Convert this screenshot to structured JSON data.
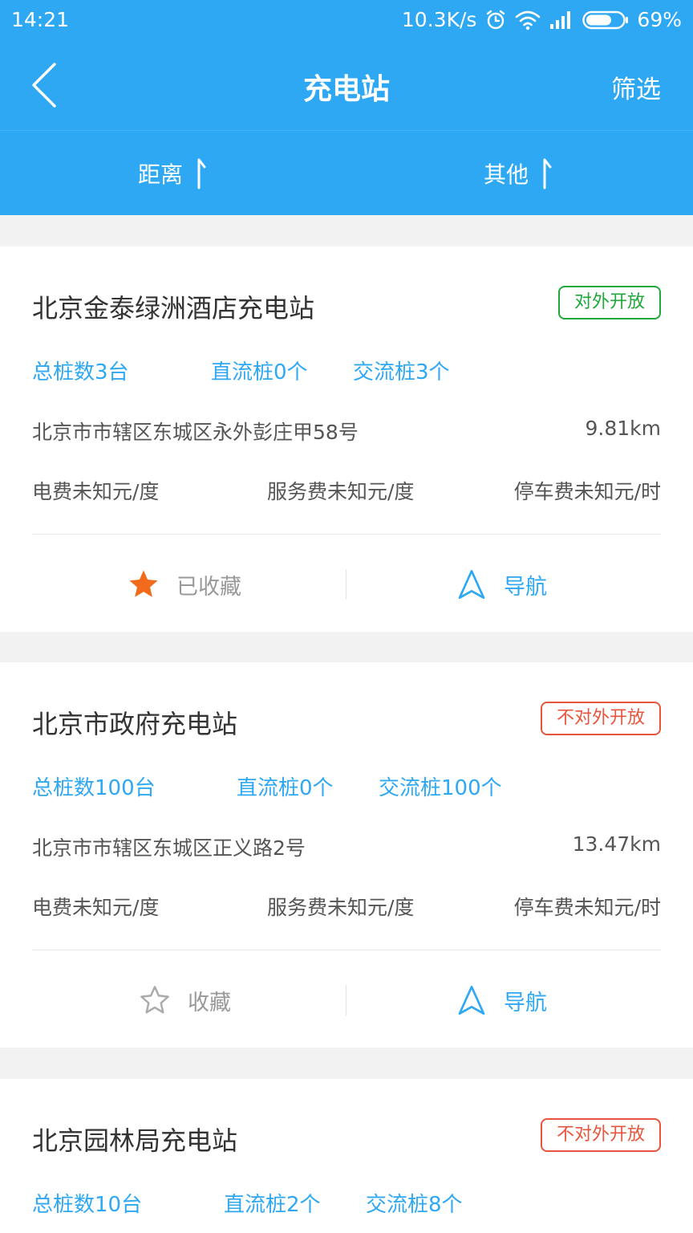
{
  "status_bar": {
    "time": "14:21",
    "net_speed": "10.3K/s",
    "battery_percent": "69%",
    "battery_level": 0.69,
    "icons": [
      "alarm-icon",
      "wifi-icon",
      "signal-icon",
      "battery-icon"
    ]
  },
  "header": {
    "title": "充电站",
    "filter_label": "筛选",
    "sort_tabs": [
      {
        "label": "距离",
        "icon": "sort-arrow-icon"
      },
      {
        "label": "其他",
        "icon": "sort-arrow-icon"
      }
    ]
  },
  "colors": {
    "primary": "#2ea8f3",
    "open": "#1fa83a",
    "closed": "#e8553d",
    "favorite_star": "#f26b1d"
  },
  "stations": [
    {
      "name": "北京金泰绿洲酒店充电站",
      "status": "对外开放",
      "total": "总桩数3台",
      "dc": "直流桩0个",
      "ac": "交流桩3个",
      "address": "北京市市辖区东城区永外彭庄甲58号",
      "distance": "9.81km",
      "electric_fee": "电费未知元/度",
      "service_fee": "服务费未知元/度",
      "parking_fee": "停车费未知元/时",
      "favorite_label": "已收藏",
      "favorited": true,
      "nav_label": "导航"
    },
    {
      "name": "北京市政府充电站",
      "status": "不对外开放",
      "total": "总桩数100台",
      "dc": "直流桩0个",
      "ac": "交流桩100个",
      "address": "北京市市辖区东城区正义路2号",
      "distance": "13.47km",
      "electric_fee": "电费未知元/度",
      "service_fee": "服务费未知元/度",
      "parking_fee": "停车费未知元/时",
      "favorite_label": "收藏",
      "favorited": false,
      "nav_label": "导航"
    },
    {
      "name": "北京园林局充电站",
      "status": "不对外开放",
      "total": "总桩数10台",
      "dc": "直流桩2个",
      "ac": "交流桩8个"
    }
  ]
}
